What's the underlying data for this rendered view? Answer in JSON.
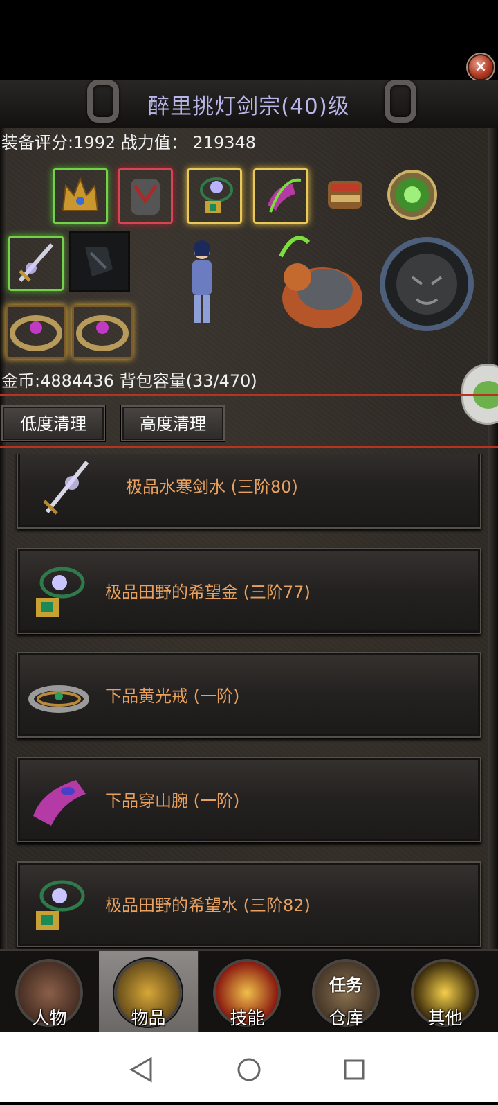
{
  "header": {
    "title": "醉里挑灯剑宗(40)级",
    "close_label": "×"
  },
  "stats": {
    "text": "装备评分:1992 战力值： 219348"
  },
  "inventory": {
    "text": "金币:4884436 背包容量(33/470)"
  },
  "actions": {
    "low_clean": "低度清理",
    "high_clean": "高度清理"
  },
  "items": [
    {
      "name": "极品水寒剑水 (三阶80)",
      "icon": "sword-icon"
    },
    {
      "name": "极品田野的希望金 (三阶77)",
      "icon": "amulet-icon"
    },
    {
      "name": "下品黄光戒 (一阶)",
      "icon": "ring-icon"
    },
    {
      "name": "下品穿山腕 (一阶)",
      "icon": "bracer-icon"
    },
    {
      "name": "极品田野的希望水 (三阶82)",
      "icon": "amulet-icon"
    }
  ],
  "tabs": [
    {
      "label": "人物",
      "icon": "character-icon"
    },
    {
      "label": "物品",
      "icon": "items-icon",
      "active": true
    },
    {
      "label": "技能",
      "icon": "skills-icon"
    },
    {
      "label": "仓库",
      "icon": "warehouse-icon",
      "badge": "任务"
    },
    {
      "label": "其他",
      "icon": "trophy-icon"
    }
  ],
  "colors": {
    "title": "#b8b6e9",
    "item_name": "#e9a160",
    "accent_line": "#b6331f"
  }
}
